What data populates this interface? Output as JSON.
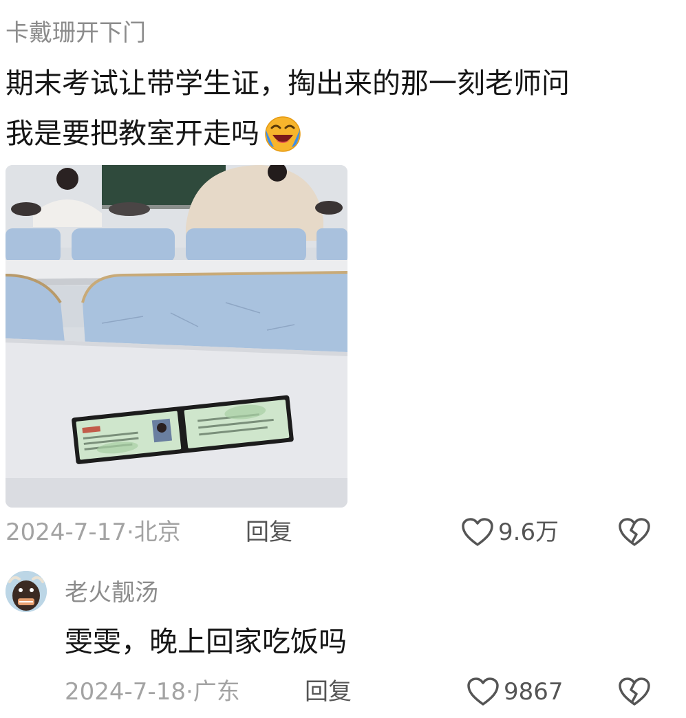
{
  "comment": {
    "username": "卡戴珊开下门",
    "text_line1": "期末考试让带学生证，掏出来的那一刻老师问",
    "text_line2": "我是要把教室开走吗",
    "emoji": "laughing-crying-emoji",
    "date": "2024-7-17",
    "location_separator": "·",
    "location": "北京",
    "reply_label": "回复",
    "like_count": "9.6万"
  },
  "reply_comment": {
    "username": "老火靓汤",
    "text": "雯雯，晚上回家吃饭吗",
    "date": "2024-7-18",
    "location_separator": "·",
    "location": "广东",
    "reply_label": "回复",
    "like_count": "9867"
  },
  "icons": {
    "like": "heart-outline-icon",
    "dislike": "broken-heart-icon"
  },
  "colors": {
    "primary_text": "#161616",
    "secondary_text": "#8c8c8c",
    "meta_text": "#a3a3a3",
    "action_text": "#555555"
  }
}
